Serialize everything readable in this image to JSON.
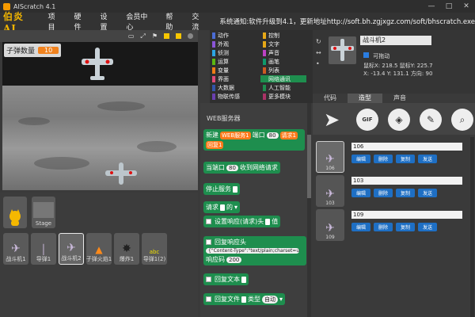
{
  "window": {
    "title": "AIScratch 4.1",
    "minimize": "—",
    "maximize": "□",
    "close": "✕"
  },
  "menu": {
    "logo": "伯炎AI",
    "items": [
      "项目",
      "硬件",
      "设置",
      "会员中心",
      "帮助",
      "交流"
    ],
    "notice": "系统通知:软件升级到4.1，更新地址http://soft.bh.zgjxgz.com/soft/bhscratch.exe"
  },
  "stage": {
    "variable_name": "子弹数量",
    "variable_value": "10"
  },
  "sprites": [
    {
      "label": "",
      "icon": "cat-icon"
    },
    {
      "label": "Stage",
      "icon": "stage-thumb"
    },
    {
      "label": "战斗机1",
      "icon": "plane-icon"
    },
    {
      "label": "导弹1",
      "icon": "missile-icon"
    },
    {
      "label": "战斗机2",
      "icon": "plane-icon"
    },
    {
      "label": "子弹火焰1",
      "icon": "flame-icon"
    },
    {
      "label": "爆炸1",
      "icon": "explosion-icon"
    },
    {
      "label": "导弹1(2)",
      "icon": "text-sprite-icon"
    }
  ],
  "categories": [
    {
      "label": "动作",
      "color": "#4a6cd4"
    },
    {
      "label": "控制",
      "color": "#e6a817"
    },
    {
      "label": "外观",
      "color": "#8a55d7"
    },
    {
      "label": "文字",
      "color": "#e6a817"
    },
    {
      "label": "侦测",
      "color": "#2ca5e2"
    },
    {
      "label": "声音",
      "color": "#bb42c3"
    },
    {
      "label": "运算",
      "color": "#5cb712"
    },
    {
      "label": "画笔",
      "color": "#0e9a6c"
    },
    {
      "label": "变量",
      "color": "#ee7d16"
    },
    {
      "label": "列表",
      "color": "#cc5b22"
    },
    {
      "label": "界面",
      "color": "#e04a7a"
    },
    {
      "label": "网络通讯",
      "color": "#1e8e4e"
    },
    {
      "label": "大数据",
      "color": "#3355aa"
    },
    {
      "label": "人工智能",
      "color": "#1e8e4e"
    },
    {
      "label": "物联传感",
      "color": "#6a3fb0"
    },
    {
      "label": "更多模块",
      "color": "#aa3366"
    }
  ],
  "blocks": {
    "header": "WEB服务器",
    "new": "新建",
    "service": "WEB服务1",
    "port_label": "端口",
    "port": "80",
    "request": "请求1",
    "reply": "回复1",
    "when_port": "当端口",
    "when_port_val": "80",
    "when_received": "收到网络请求",
    "stop_service": "停止服务",
    "request_of": "请求",
    "of": "的",
    "set_header": "设置响应(请求)头",
    "value": "值",
    "reply_header": "回复响应头",
    "content_type": "{\"Content-Type\":\"text/plain;charset=utf-8\"}",
    "status_code": "响应码",
    "status_val": "200",
    "reply_text": "回复文本",
    "reply_file": "回复文件",
    "type": "类型",
    "auto": "自动"
  },
  "sprite_info": {
    "name": "战斗机2",
    "draggable": "可拖动",
    "mouse": "鼠标X: 218.5   鼠标Y: 225.7",
    "pos": "X: -13.4   Y: 131.1   方向: 90"
  },
  "tabs": [
    "代码",
    "造型",
    "声音"
  ],
  "costumes": [
    {
      "num": "106",
      "name": "106"
    },
    {
      "num": "103",
      "name": "103"
    },
    {
      "num": "109",
      "name": "109"
    }
  ],
  "costume_buttons": [
    "编辑",
    "删除",
    "复制",
    "发送"
  ]
}
